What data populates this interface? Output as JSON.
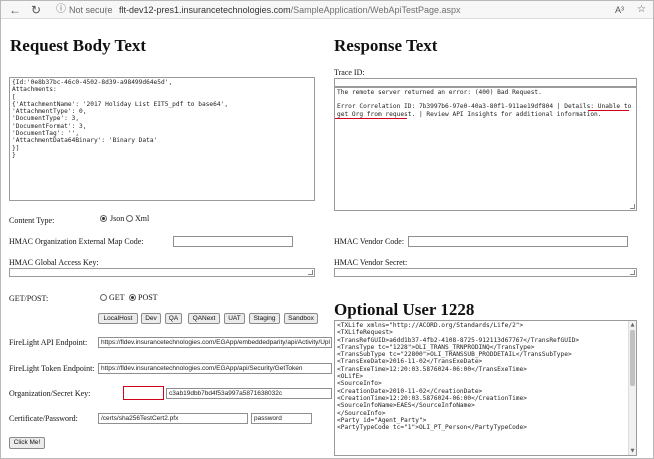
{
  "browser": {
    "back_icon": "←",
    "reload_icon": "↻",
    "info_icon": "ⓘ",
    "security_text": "Not secure",
    "separator": "|",
    "url_host": "flt-dev12-pres1.insurancetechnologies.com",
    "url_path": "/SampleApplication/WebApiTestPage.aspx",
    "read_aloud_icon": "A³",
    "favorite_icon": "☆"
  },
  "request": {
    "title": "Request Body Text",
    "body": "{Id:'0e8b37bc-46c0-4502-8d39-a98499d64e5d',\nAttachments:\n[\n{'AttachmentName': '2017 Holiday List EIT5_pdf to base64',\n'AttachmentType': 0,\n'DocumentType': 3,\n'DocumentFormat': 3,\n'DocumentTag': '',\n'AttachmentData64Binary': 'Binary Data'\n}]\n}",
    "content_type_label": "Content Type:",
    "json_label": "Json",
    "xml_label": "Xml",
    "hmac_org_map_label": "HMAC Organization External Map Code:",
    "hmac_org_map_value": "",
    "hmac_global_label": "HMAC Global Access Key:",
    "get_post_label": "GET/POST:",
    "get_label": "GET",
    "post_label": "POST",
    "env_buttons": [
      "LocalHost",
      "Dev",
      "QA",
      "QANext",
      "UAT",
      "Staging",
      "Sandbox"
    ],
    "api_endpoint_label": "FireLight API Endpoint:",
    "api_endpoint_value": "https://fldev.insurancetechnologies.com/EGApp/embeddedparity/api/Activity/Upl",
    "token_endpoint_label": "FireLight Token Endpoint:",
    "token_endpoint_value": "https://fldev.insurancetechnologies.com/EGApp/api/Security/GetToken",
    "org_secret_label": "Organization/Secret Key:",
    "org_value": "",
    "secret_value": "c3ab19dbb7bd4f53a997a5871638032c",
    "cert_label": "Certificate/Password:",
    "cert_value": "/certs/sha256TestCert2.pfx",
    "password_value": "password",
    "submit_label": "Click Me!"
  },
  "response": {
    "title": "Response Text",
    "trace_label": "Trace ID:",
    "trace_value": "",
    "body_line1": "The remote server returned an error: (400) Bad Request.",
    "body_line2": "Error Correlation ID: 7b3997b6-97e0-40a3-80f1-911ae19df804 | Details: Unable to",
    "body_line3": "get Org from request. | Review API Insights for additional information.",
    "hmac_vendor_code_label": "HMAC Vendor Code:",
    "hmac_vendor_code_value": "",
    "hmac_vendor_secret_label": "HMAC Vendor Secret:"
  },
  "optional": {
    "title": "Optional User 1228",
    "xml": "<TXLife xmlns=\"http://ACORD.org/Standards/Life/2\">\n<TXLifeRequest>\n<TransRefGUID>a6dd1b37-4fb2-4108-8725-912113d67767</TransRefGUID>\n<TransType tc=\"1228\">OLI_TRANS_TRNPRODINQ</TransType>\n<TransSubType tc=\"22800\">OLI_TRANSSUB_PRODDETAIL</TransSubType>\n<TransExeDate>2016-11-02</TransExeDate>\n<TransExeTime>12:20:03.5876024-06:00</TransExeTime>\n<OLifE>\n<SourceInfo>\n<CreationDate>2010-11-02</CreationDate>\n<CreationTime>12:20:03.5876024-06:00</CreationTime>\n<SourceInfoName>EAES</SourceInfoName>\n</SourceInfo>\n<Party id=\"Agent_Party\">\n<PartyTypeCode tc=\"1\">OLI_PT_Person</PartyTypeCode>"
  },
  "colors": {
    "highlight_red": "#d0021b"
  }
}
